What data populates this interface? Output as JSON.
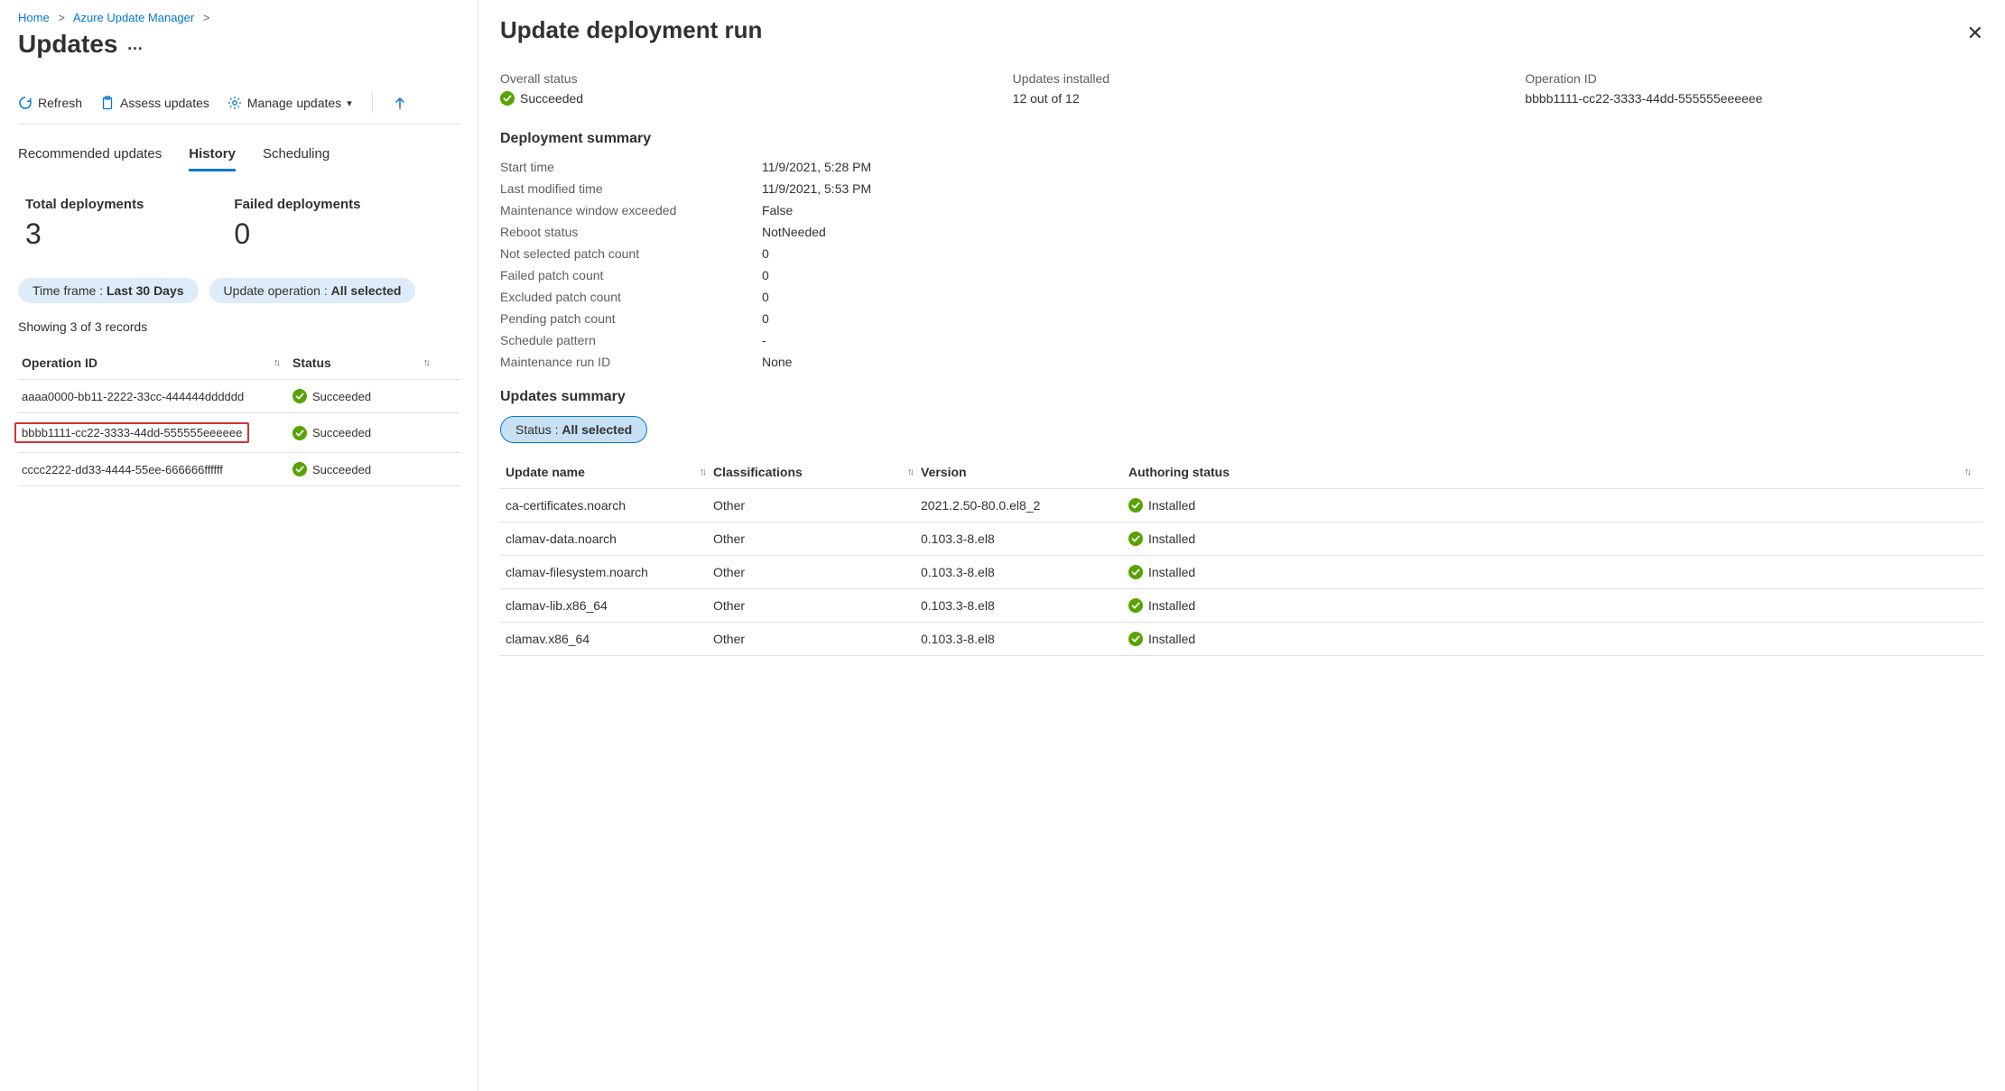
{
  "breadcrumb": {
    "home": "Home",
    "azure_update_manager": "Azure Update Manager"
  },
  "page_title": "Updates",
  "toolbar": {
    "refresh": "Refresh",
    "assess": "Assess updates",
    "manage": "Manage updates"
  },
  "tabs": {
    "recommended": "Recommended updates",
    "history": "History",
    "scheduling": "Scheduling"
  },
  "stats": {
    "total_label": "Total deployments",
    "total_value": "3",
    "failed_label": "Failed deployments",
    "failed_value": "0"
  },
  "filters": {
    "timeframe_label": "Time frame : ",
    "timeframe_value": "Last 30 Days",
    "operation_label": "Update operation : ",
    "operation_value": "All selected"
  },
  "records_text": "Showing 3 of 3 records",
  "columns": {
    "operation_id": "Operation ID",
    "status": "Status"
  },
  "rows": [
    {
      "op_id": "aaaa0000-bb11-2222-33cc-444444dddddd",
      "status": "Succeeded",
      "selected": false
    },
    {
      "op_id": "bbbb1111-cc22-3333-44dd-555555eeeeee",
      "status": "Succeeded",
      "selected": true
    },
    {
      "op_id": "cccc2222-dd33-4444-55ee-666666ffffff",
      "status": "Succeeded",
      "selected": false
    }
  ],
  "panel": {
    "title": "Update deployment run",
    "overall_status_label": "Overall status",
    "overall_status_value": "Succeeded",
    "updates_installed_label": "Updates installed",
    "updates_installed_value": "12 out of 12",
    "operation_id_label": "Operation ID",
    "operation_id_value": "bbbb1111-cc22-3333-44dd-555555eeeeee",
    "deployment_summary": "Deployment summary",
    "kv": [
      {
        "k": "Start time",
        "v": "11/9/2021, 5:28 PM"
      },
      {
        "k": "Last modified time",
        "v": "11/9/2021, 5:53 PM"
      },
      {
        "k": "Maintenance window exceeded",
        "v": "False"
      },
      {
        "k": "Reboot status",
        "v": "NotNeeded"
      },
      {
        "k": "Not selected patch count",
        "v": "0"
      },
      {
        "k": "Failed patch count",
        "v": "0"
      },
      {
        "k": "Excluded patch count",
        "v": "0"
      },
      {
        "k": "Pending patch count",
        "v": "0"
      },
      {
        "k": "Schedule pattern",
        "v": "-"
      },
      {
        "k": "Maintenance run ID",
        "v": "None"
      }
    ],
    "updates_summary": "Updates summary",
    "updates_filter_label": "Status : ",
    "updates_filter_value": "All selected",
    "updates_columns": {
      "name": "Update name",
      "class": "Classifications",
      "ver": "Version",
      "auth": "Authoring status"
    },
    "updates_rows": [
      {
        "name": "ca-certificates.noarch",
        "class": "Other",
        "ver": "2021.2.50-80.0.el8_2",
        "auth": "Installed"
      },
      {
        "name": "clamav-data.noarch",
        "class": "Other",
        "ver": "0.103.3-8.el8",
        "auth": "Installed"
      },
      {
        "name": "clamav-filesystem.noarch",
        "class": "Other",
        "ver": "0.103.3-8.el8",
        "auth": "Installed"
      },
      {
        "name": "clamav-lib.x86_64",
        "class": "Other",
        "ver": "0.103.3-8.el8",
        "auth": "Installed"
      },
      {
        "name": "clamav.x86_64",
        "class": "Other",
        "ver": "0.103.3-8.el8",
        "auth": "Installed"
      }
    ]
  }
}
